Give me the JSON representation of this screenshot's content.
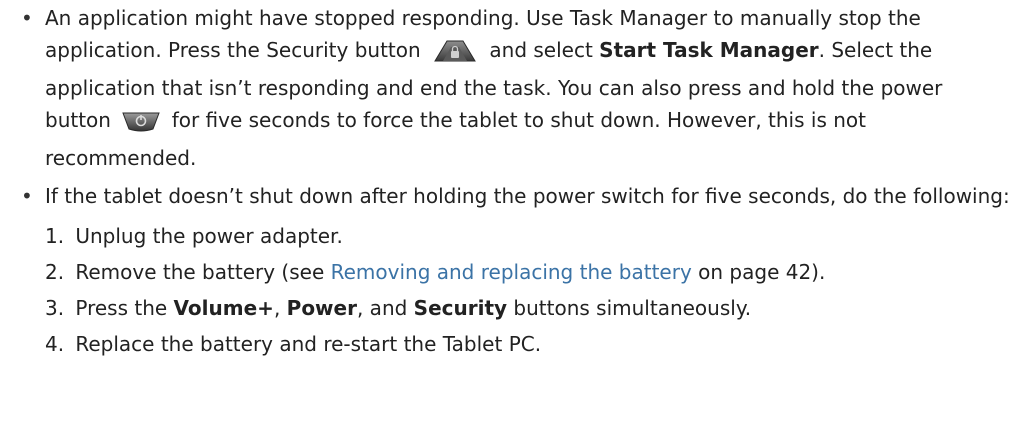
{
  "bullets": [
    {
      "marker": "•",
      "segments": {
        "t1": "An application might have stopped responding. Use Task Manager to manually stop the application. Press the Security button",
        "t2": "and select",
        "b1": "Start Task Manager",
        "t3": ". Select the application that isn’t responding and end the task. You can also press and hold the power button",
        "t4": "for five seconds to force the tablet to shut down. However, this is not recommended."
      },
      "icons": [
        "security-button-icon",
        "power-button-icon"
      ]
    },
    {
      "marker": "•",
      "text": "If the tablet doesn’t shut down after holding the power switch for five seconds, do the following:"
    }
  ],
  "steps": [
    {
      "num": "1.",
      "text": "Unplug the power adapter."
    },
    {
      "num": "2.",
      "pre": "Remove the battery (see ",
      "link": "Removing and replacing the battery",
      "post": " on page 42)."
    },
    {
      "num": "3.",
      "pre": "Press the ",
      "b1": "Volume+",
      "mid1": ", ",
      "b2": "Power",
      "mid2": ", and ",
      "b3": "Security",
      "post": " buttons simultaneously."
    },
    {
      "num": "4.",
      "text": "Replace the battery and re-start the Tablet PC."
    }
  ],
  "colors": {
    "text": "#222222",
    "link": "#3b73a6",
    "icon_dark": "#4a4a4a",
    "icon_light": "#9a9a9a"
  }
}
